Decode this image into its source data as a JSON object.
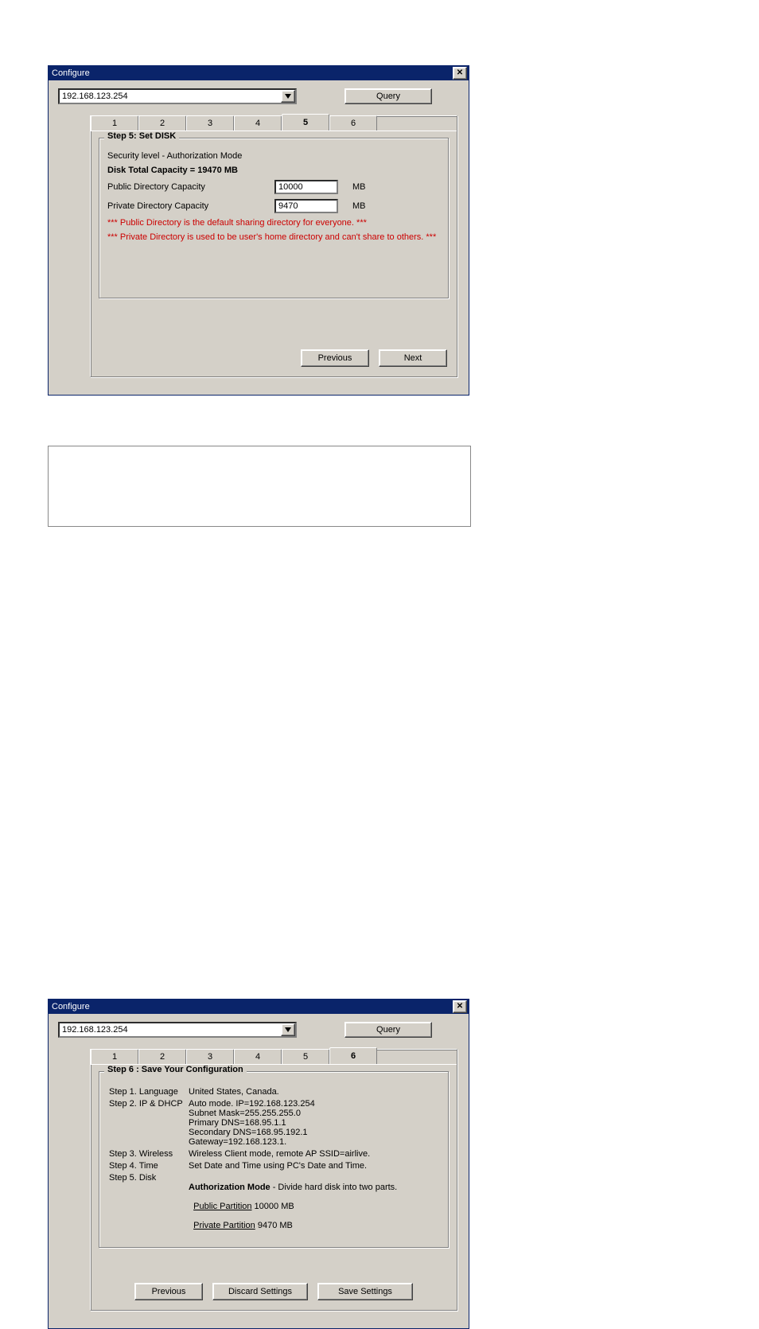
{
  "window_title": "Configure",
  "ip_value": "192.168.123.254",
  "query_label": "Query",
  "tabs": [
    "1",
    "2",
    "3",
    "4",
    "5",
    "6"
  ],
  "dlg1": {
    "active_tab": 4,
    "legend": "Step 5: Set DISK",
    "security_line": "Security level - Authorization Mode",
    "capacity_line": "Disk Total Capacity = 19470 MB",
    "public_label": "Public Directory Capacity",
    "public_value": "10000",
    "private_label": "Private Directory Capacity",
    "private_value": "9470",
    "unit": "MB",
    "note1": "*** Public Directory is the default sharing directory for everyone. ***",
    "note2": "*** Private Directory is used to be user's home directory and can't share to others. ***",
    "btn_prev": "Previous",
    "btn_next": "Next"
  },
  "dlg2": {
    "active_tab": 5,
    "legend": "Step 6 : Save Your Configuration",
    "rows": {
      "r1_label": "Step 1. Language",
      "r1_value": "United States, Canada.",
      "r2_label": "Step 2. IP & DHCP",
      "r2_value": "Auto mode. IP=192.168.123.254\nSubnet Mask=255.255.255.0\nPrimary DNS=168.95.1.1\nSecondary DNS=168.95.192.1\nGateway=192.168.123.1.",
      "r3_label": "Step 3. Wireless",
      "r3_value": "Wireless Client mode, remote AP SSID=airlive.",
      "r4_label": "Step 4. Time",
      "r4_value": "Set Date and Time using PC's Date and Time.",
      "r5_label": "Step 5. Disk",
      "r5_lead_bold": "Authorization Mode",
      "r5_lead_tail": " - Divide hard disk into two parts.",
      "r5_line2_u": "Public Partition",
      "r5_line2_t": " 10000 MB",
      "r5_line3_u": "Private Partition",
      "r5_line3_t": " 9470 MB"
    },
    "btn_prev": "Previous",
    "btn_discard": "Discard Settings",
    "btn_save": "Save Settings"
  }
}
